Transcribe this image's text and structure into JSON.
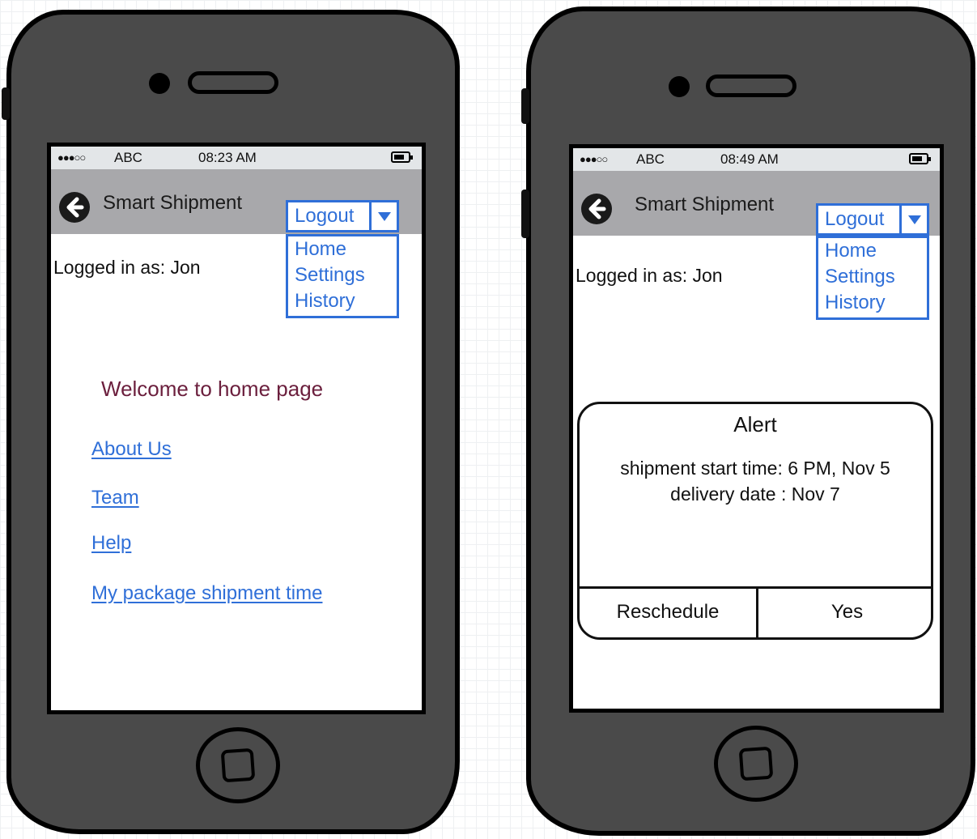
{
  "left_screen": {
    "status": {
      "signal": "●●●○○",
      "carrier": "ABC",
      "time": "08:23 AM"
    },
    "nav": {
      "title": "Smart Shipment",
      "dropdown_label": "Logout"
    },
    "menu": [
      "Home",
      "Settings",
      "History"
    ],
    "logged_in": "Logged in as: Jon",
    "welcome": "Welcome to home page",
    "links": [
      "About Us",
      "Team",
      "Help",
      "My package shipment time"
    ]
  },
  "right_screen": {
    "status": {
      "signal": "●●●○○",
      "carrier": "ABC",
      "time": "08:49 AM"
    },
    "nav": {
      "title": "Smart Shipment",
      "dropdown_label": "Logout"
    },
    "menu": [
      "Home",
      "Settings",
      "History"
    ],
    "logged_in": "Logged in as: Jon",
    "alert": {
      "title": "Alert",
      "line1": "shipment start time: 6 PM, Nov 5",
      "line2": "delivery date : Nov 7",
      "button_left": "Reschedule",
      "button_right": "Yes"
    }
  },
  "colors": {
    "phone_body": "#4a4a4a",
    "nav_bar": "#a8a8ab",
    "status_bar": "#e3e6e8",
    "link": "#2f6fd8",
    "welcome": "#6b1f3d"
  }
}
